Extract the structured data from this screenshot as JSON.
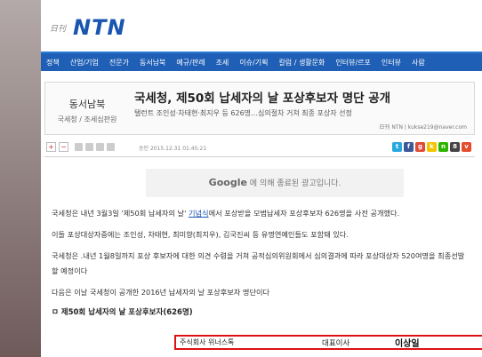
{
  "header": {
    "logo_small": "日刊",
    "logo_main": "NTN"
  },
  "nav": {
    "items": [
      "정책",
      "산업/기업",
      "전문가",
      "동서남북",
      "예규/판례",
      "조세",
      "이슈/기획",
      "칼럼 / 생활문화",
      "인터뷰/르포",
      "인터뷰",
      "사람"
    ]
  },
  "category": {
    "title": "동서남북",
    "sub": "국세청 / 조세심판원"
  },
  "article": {
    "headline": "국세청, 제50회 납세자의 날 포상후보자 명단 공개",
    "subhead": "탤런트 조인성·차태현·최지우 등 626명…심의절차 거쳐 최종 포상자 선정",
    "byline": "日刊 NTN  |  kukse219@naver.com",
    "date": "승인 2015.12.31  01:45:21"
  },
  "toolbar": {
    "plus": "+",
    "minus": "−"
  },
  "share_icons": [
    {
      "icon": "t",
      "color": "#29a9e0"
    },
    {
      "icon": "f",
      "color": "#3b5998"
    },
    {
      "icon": "g",
      "color": "#dd4b39"
    },
    {
      "icon": "k",
      "color": "#f2c500"
    },
    {
      "icon": "n",
      "color": "#2db400"
    },
    {
      "icon": "8",
      "color": "#444444"
    },
    {
      "icon": "v",
      "color": "#e44c2c"
    }
  ],
  "ad": {
    "brand": "Google",
    "text": "에 의해 종료된 광고입니다."
  },
  "body": {
    "p1_a": "국세청은 내년 3월3일 '제50회 납세자의 날' ",
    "p1_link": "기념식",
    "p1_b": "에서 포상받을 모범납세자 포상후보자 626명을 사전 공개했다.",
    "p2": "이들 포상대상자중에는 조인성, 차태현, 최미향(최지우), 김국진씨 등 유명연예인들도 포함돼 있다.",
    "p3": "국세청은 .내년 1월8일까지 포상 후보자에 대한 의견 수렴을 거쳐 공적심의위원회에서 심의결과에 따라 포상대상자 520여명을 최종선발할 예정이다",
    "p4": "다음은 이날 국세청이 공개한 2016년 납세자의 날 포상후보자 명단이다",
    "list_title": "ㅁ 제50회 납세자의 날 포상후보자(626명)"
  },
  "overlay": {
    "company": "주식회사 위너스톡",
    "role": "대표이사",
    "name": "이상일"
  }
}
